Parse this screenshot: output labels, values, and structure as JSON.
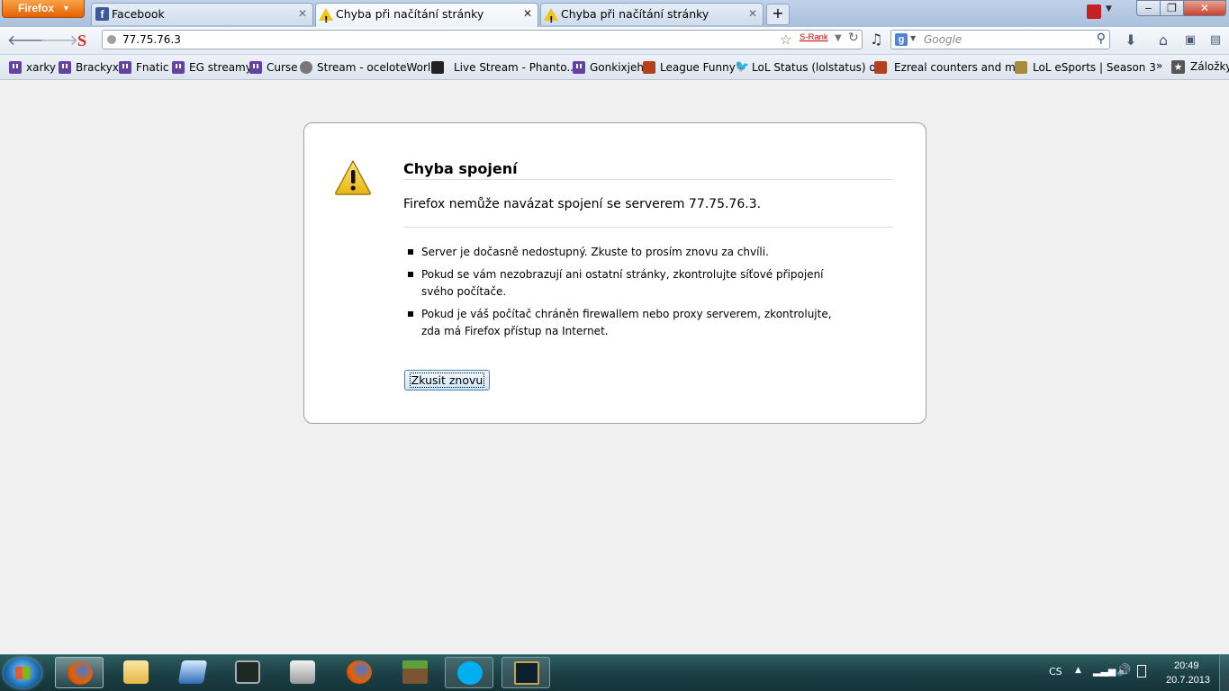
{
  "browser": {
    "menu_button": "Firefox",
    "tabs": [
      {
        "label": "Facebook"
      },
      {
        "label": "Chyba při načítání stránky"
      },
      {
        "label": "Chyba při načítání stránky"
      }
    ],
    "url": "77.75.76.3",
    "srank": "S-Rank",
    "search_placeholder": "Google"
  },
  "bookmarks": [
    {
      "label": "xarky",
      "icon": "twitch-icon"
    },
    {
      "label": "Brackyx",
      "icon": "twitch-icon"
    },
    {
      "label": "Fnatic",
      "icon": "twitch-icon"
    },
    {
      "label": "EG streamy",
      "icon": "twitch-icon"
    },
    {
      "label": "Curse",
      "icon": "twitch-icon"
    },
    {
      "label": "Stream - oceloteWorld",
      "icon": "globe-icon"
    },
    {
      "label": "Live Stream - Phanto...",
      "icon": "skull-icon"
    },
    {
      "label": "Gonkixjeh",
      "icon": "twitch-icon"
    },
    {
      "label": "League Funny",
      "icon": "champion-icon"
    },
    {
      "label": "LoL Status (lolstatus) o...",
      "icon": "twitter-icon"
    },
    {
      "label": "Ezreal counters and m...",
      "icon": "champion-icon"
    },
    {
      "label": "LoL eSports | Season 3",
      "icon": "lol-esports-icon"
    }
  ],
  "bookmarks_more": "»",
  "bookmarks_folder": "Záložky",
  "error": {
    "title": "Chyba spojení",
    "description": "Firefox nemůže navázat spojení se serverem 77.75.76.3.",
    "items": [
      "Server je dočasně nedostupný. Zkuste to prosím znovu za chvíli.",
      "Pokud se vám nezobrazují ani ostatní stránky, zkontrolujte síťové připojení svého počítače.",
      "Pokud je váš počítač chráněn firewallem nebo proxy serverem, zkontrolujte, zda má Firefox přístup na Internet."
    ],
    "retry_button": "Zkusit znovu"
  },
  "taskbar": {
    "apps": [
      "firefox-icon",
      "explorer-icon",
      "remote-desktop-icon",
      "task-manager-icon",
      "printer-icon",
      "firefox-icon",
      "minecraft-icon",
      "skype-icon",
      "league-of-legends-icon"
    ],
    "language": "CS",
    "time": "20:49",
    "date": "20.7.2013"
  },
  "colors": {
    "firefox_orange": "#e66000",
    "twitch_purple": "#6441a5",
    "warning_yellow": "#f0c419",
    "taskbar": "#1b3f45"
  }
}
